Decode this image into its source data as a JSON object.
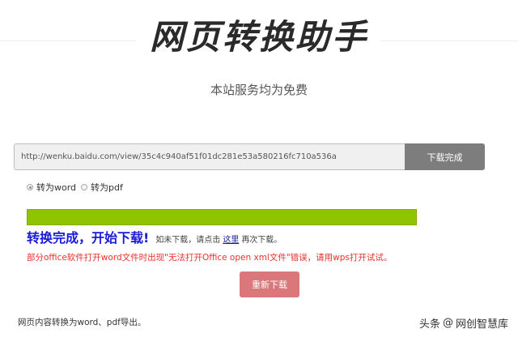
{
  "header": {
    "logo_text": "网页转换助手",
    "subtitle": "本站服务均为免费"
  },
  "converter": {
    "url_value": "http://wenku.baidu.com/view/35c4c940af51f01dc281e53a580216fc710a536a",
    "button_label": "下载完成"
  },
  "format_options": [
    {
      "label": "转为word",
      "checked": true
    },
    {
      "label": "转为pdf",
      "checked": false
    }
  ],
  "progress": {
    "fraction": 1.0
  },
  "result": {
    "headline": "转换完成，开始下载!",
    "hint_before": "如未下载，请点击",
    "hint_link": "这里",
    "hint_after": "再次下载。",
    "error_note": "部分office软件打开word文件时出现\"无法打开Office open xml文件\"错误，请用wps打开试试。",
    "redownload_label": "重新下载"
  },
  "footer": {
    "text": "网页内容转换为word、pdf导出。"
  },
  "watermark": {
    "prefix": "头条",
    "handle": "网创智慧库"
  },
  "colors": {
    "progress_fill": "#8fc400",
    "headline": "#1a1ad8",
    "error": "#e8312f",
    "redownload_button": "#d9777a",
    "convert_button": "#7d7d7d"
  }
}
